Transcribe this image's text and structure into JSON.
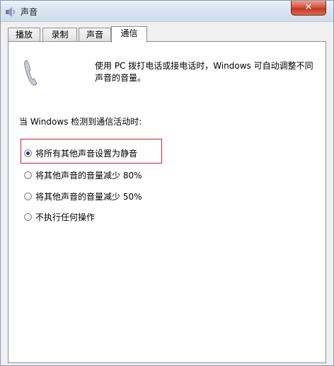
{
  "window": {
    "title": "声音",
    "close_label": "✕"
  },
  "tabs": [
    {
      "label": "播放",
      "active": false
    },
    {
      "label": "录制",
      "active": false
    },
    {
      "label": "声音",
      "active": false
    },
    {
      "label": "通信",
      "active": true
    }
  ],
  "communications": {
    "description_line1": "使用 PC 拨打电话或接电话时，Windows 可自动调整不同",
    "description_line2": "声音的音量。",
    "section_label": "当 Windows 检测到通信活动时:",
    "options": [
      {
        "label": "将所有其他声音设置为静音",
        "checked": true
      },
      {
        "label": "将其他声音的音量减少 80%",
        "checked": false
      },
      {
        "label": "将其他声音的音量减少 50%",
        "checked": false
      },
      {
        "label": "不执行任何操作",
        "checked": false
      }
    ]
  },
  "icons": {
    "title": "speaker-icon",
    "phone": "phone-icon"
  },
  "colors": {
    "highlight_border": "#c5242b",
    "close_button": "#c2381f"
  }
}
